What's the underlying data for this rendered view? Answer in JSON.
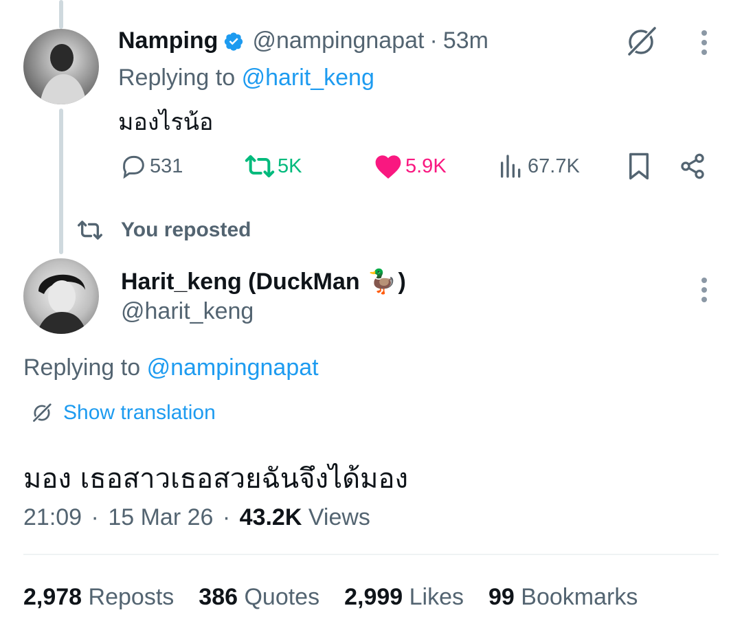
{
  "tweet1": {
    "display_name": "Namping",
    "handle": "@nampingnapat",
    "separator": "·",
    "time": "53m",
    "replying_prefix": "Replying to",
    "replying_to": "@harit_keng",
    "text": "มองไรน้อ",
    "stats": {
      "replies": "531",
      "reposts": "5K",
      "likes": "5.9K",
      "views": "67.7K"
    }
  },
  "repost_banner": "You reposted",
  "tweet2": {
    "display_name": "Harit_keng (DuckMan ",
    "emoji": "🦆",
    "name_close": ")",
    "handle": "@harit_keng",
    "replying_prefix": "Replying to",
    "replying_to": "@nampingnapat",
    "show_translation": "Show translation",
    "text": "มอง เธอสาวเธอสวยฉันจึงได้มอง",
    "time": "21:09",
    "date": "15 Mar 26",
    "views_count": "43.2K",
    "views_label": "Views",
    "separator": "·"
  },
  "engagement": {
    "reposts_count": "2,978",
    "reposts_label": "Reposts",
    "quotes_count": "386",
    "quotes_label": "Quotes",
    "likes_count": "2,999",
    "likes_label": "Likes",
    "bookmarks_count": "99",
    "bookmarks_label": "Bookmarks"
  },
  "colors": {
    "accent": "#1d9bf0",
    "repost_green": "#00ba7c",
    "like_pink": "#f91880",
    "muted": "#536471"
  }
}
